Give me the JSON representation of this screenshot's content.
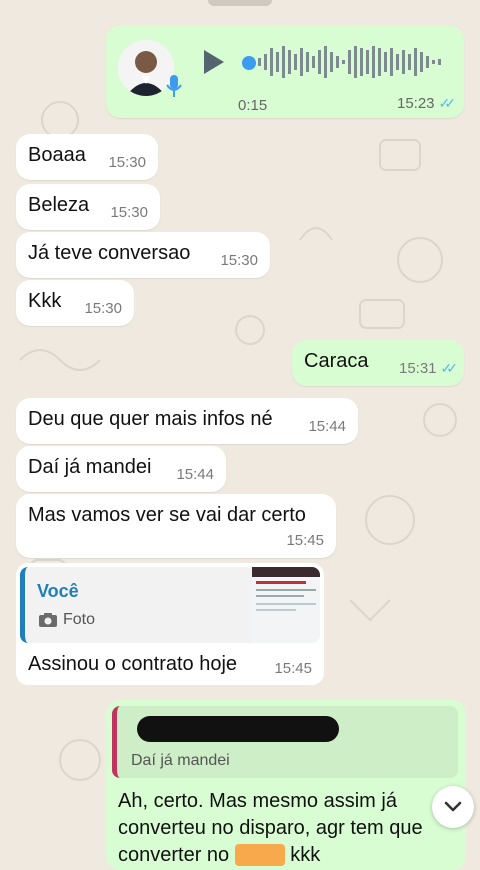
{
  "colors": {
    "incoming": "#ffffff",
    "outgoing": "#d9fdd3",
    "read_ticks": "#53bdeb",
    "reply_accent_you": "#1f7fb8",
    "reply_accent_out": "#c0345f",
    "highlight": "#f8a94b"
  },
  "voice": {
    "duration": "0:15",
    "time": "15:23",
    "ticks": "✓✓",
    "play_icon": "play-icon",
    "mic_icon": "mic-icon"
  },
  "messages": [
    {
      "text": "Boaaa",
      "time": "15:30"
    },
    {
      "text": "Beleza",
      "time": "15:30"
    },
    {
      "text": "Já teve conversao",
      "time": "15:30"
    },
    {
      "text": "Kkk",
      "time": "15:30"
    },
    {
      "text": "Caraca",
      "time": "15:31",
      "ticks": "✓✓"
    },
    {
      "text": "Deu que quer mais infos né",
      "time": "15:44"
    },
    {
      "text": "Daí já mandei",
      "time": "15:44"
    },
    {
      "text": "Mas vamos ver se vai dar certo",
      "time": "15:45"
    }
  ],
  "reply_card": {
    "quoted_author": "Você",
    "quoted_type": "Foto",
    "text": "Assinou o contrato hoje",
    "time": "15:45"
  },
  "out_reply": {
    "quoted_text": "Daí já mandei",
    "body_line1": "Ah, certo. Mas mesmo assim já",
    "body_line2": "converteu no disparo, agr tem que",
    "body_line3_visible": "converter no",
    "body_line3_tail": "kkk"
  },
  "scroll_icon": "chevron-down-icon"
}
